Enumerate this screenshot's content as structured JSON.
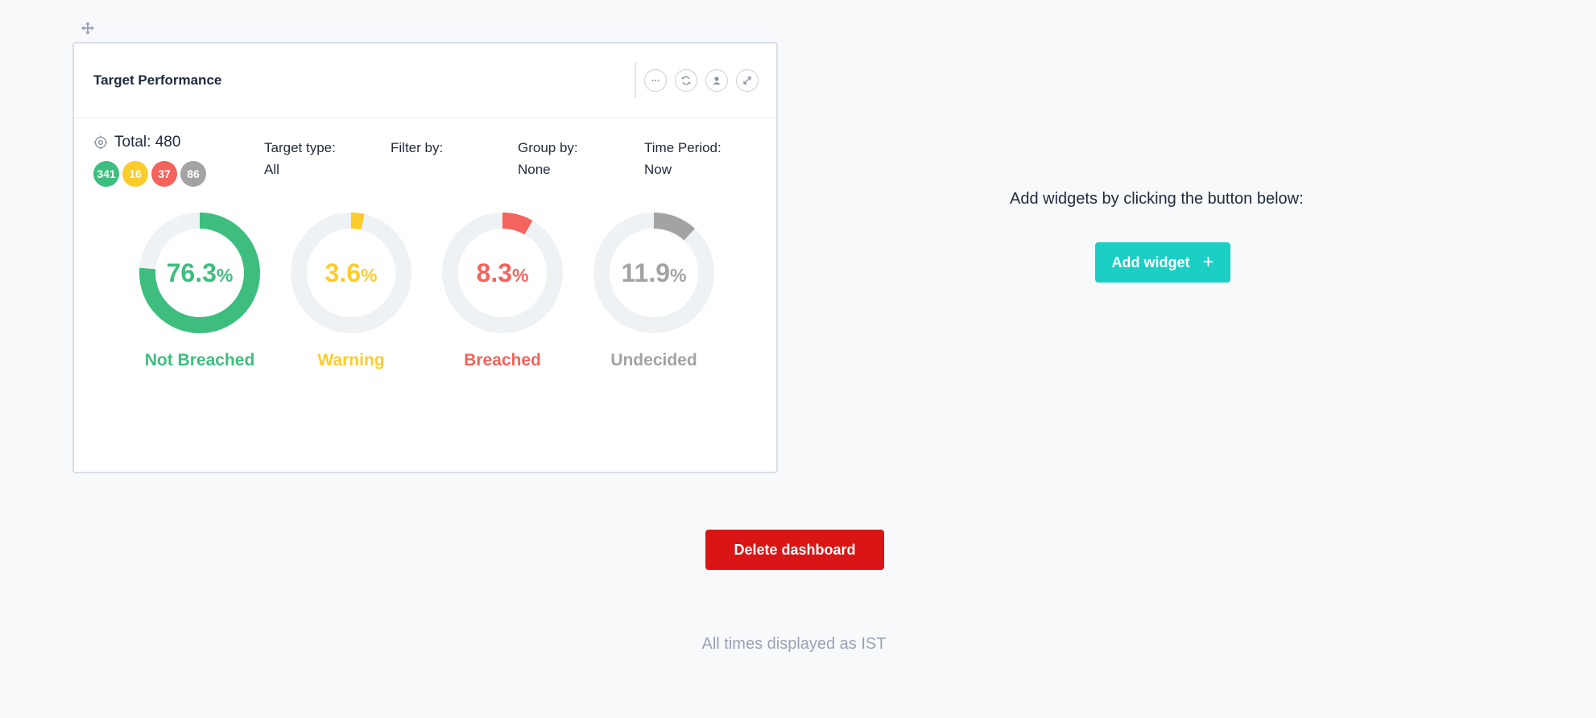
{
  "widget": {
    "title": "Target Performance",
    "total_label": "Total: 480",
    "badges": [
      {
        "value": "341",
        "color": "#3dbe7e"
      },
      {
        "value": "16",
        "color": "#fccc2c"
      },
      {
        "value": "37",
        "color": "#f4635c"
      },
      {
        "value": "86",
        "color": "#a3a3a3"
      }
    ],
    "meta": [
      {
        "label": "Target type:",
        "value": "All"
      },
      {
        "label": "Filter by:",
        "value": ""
      },
      {
        "label": "Group by:",
        "value": "None"
      },
      {
        "label": "Time Period:",
        "value": "Now"
      }
    ],
    "donuts": [
      {
        "value": "76.3",
        "unit": "%",
        "fraction": 0.763,
        "label": "Not Breached",
        "color": "#3dbe7e"
      },
      {
        "value": "3.6",
        "unit": "%",
        "fraction": 0.036,
        "label": "Warning",
        "color": "#fccc2c"
      },
      {
        "value": "8.3",
        "unit": "%",
        "fraction": 0.083,
        "label": "Breached",
        "color": "#f4635c"
      },
      {
        "value": "11.9",
        "unit": "%",
        "fraction": 0.119,
        "label": "Undecided",
        "color": "#a3a3a3"
      }
    ],
    "track_color": "#eff2f4",
    "header_icons": [
      "more-icon",
      "refresh-icon",
      "user-icon",
      "expand-icon"
    ]
  },
  "add_widget": {
    "prompt": "Add widgets by clicking the button below:",
    "button_label": "Add widget",
    "button_icon": "+"
  },
  "delete_button_label": "Delete dashboard",
  "footer_note": "All times displayed as IST"
}
